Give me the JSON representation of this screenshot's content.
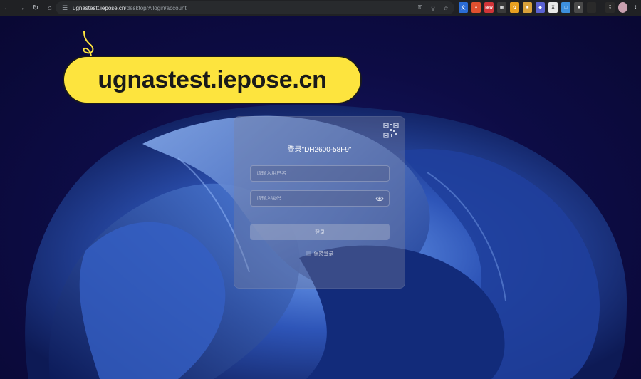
{
  "browser": {
    "url_host": "ugnastestt.iepose.cn",
    "url_path": "/desktop/#/login/account",
    "icons": {
      "back": "arrow-left-icon",
      "forward": "arrow-right-icon",
      "reload": "reload-icon",
      "home": "home-icon",
      "site_info": "tune-icon",
      "password": "key-icon",
      "zoom": "zoom-icon",
      "bookmark": "star-icon"
    },
    "extension_badge": "New"
  },
  "annotation": {
    "callout_text": "ugnastest.iepose.cn",
    "color": "#fde43e"
  },
  "login": {
    "title": "登录\"DH2600-58F9\"",
    "username_placeholder": "请输入用户名",
    "password_placeholder": "请输入密码",
    "submit_label": "登录",
    "remember_label": "保持登录"
  }
}
